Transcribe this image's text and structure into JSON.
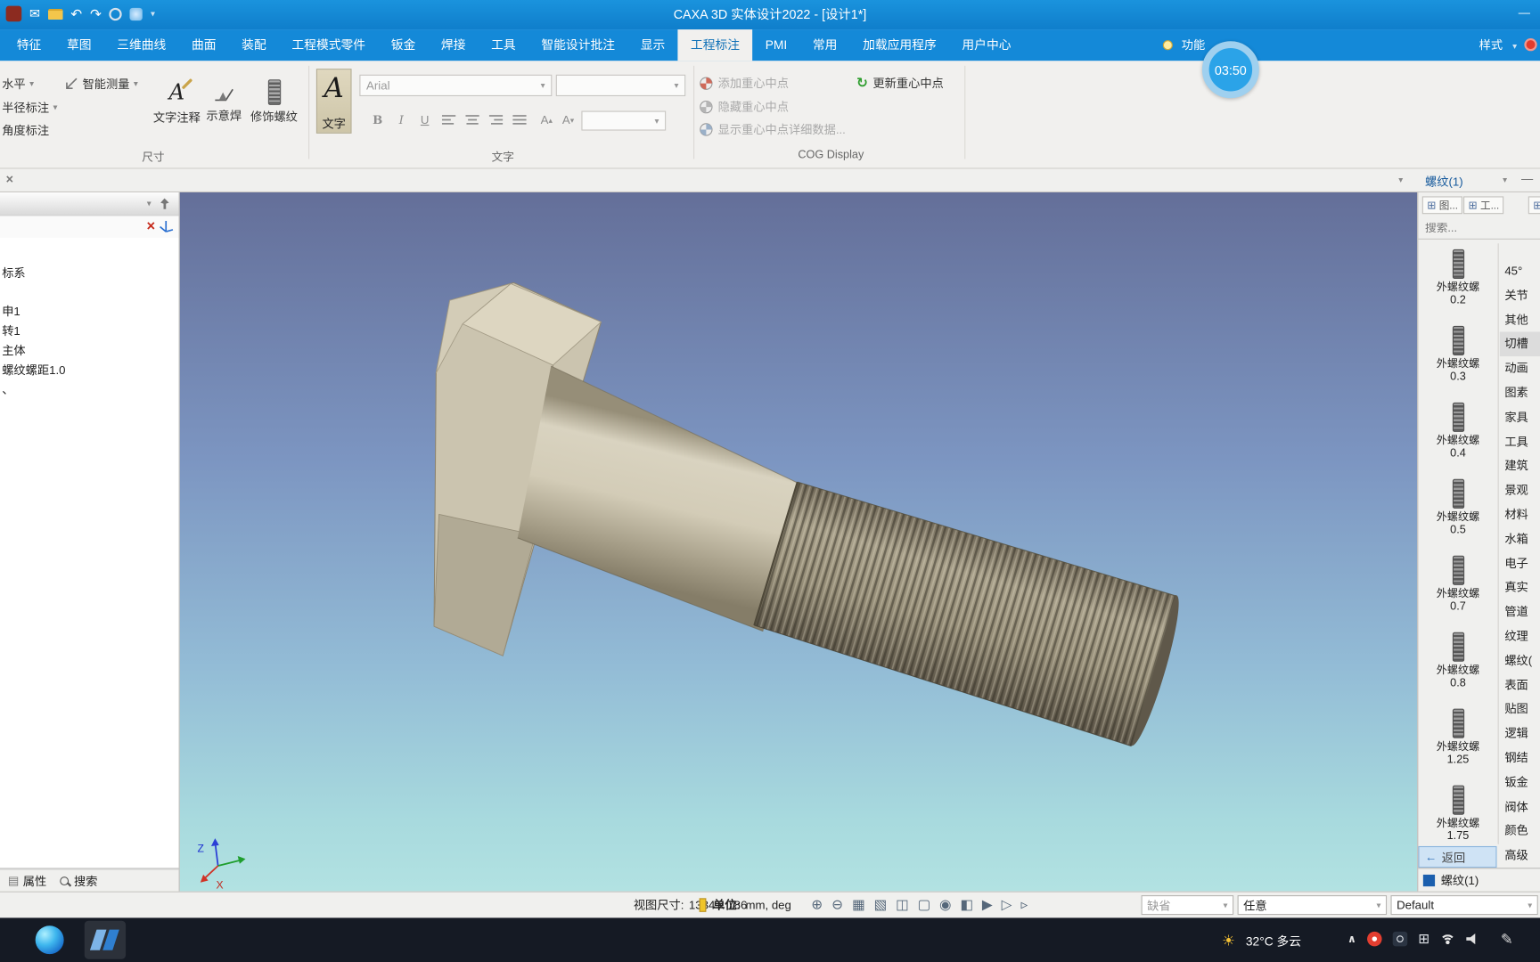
{
  "colors": {
    "titlebar_blue": "#1489d8",
    "accent_blue": "#1272b8",
    "ribbon_bg": "#f1f0ee",
    "viewport_top": "#646f99",
    "viewport_bottom": "#b2e2e2",
    "bolt_body": "#cbc4af",
    "thread_dark": "#5f584a",
    "taskbar_bg": "#151a24",
    "timer_bg": "#2ba3e8"
  },
  "icons": {
    "dropdown": "▾",
    "close": "×",
    "undo": "↶",
    "redo": "↷",
    "mail": "✉",
    "refresh": "↻",
    "back_arrow": "←",
    "chevron_up": "∧",
    "pen": "✎",
    "sun": "☀",
    "grid": "⊞",
    "tree_icon": "▤",
    "minimize": "—"
  },
  "titlebar": {
    "title": "CAXA 3D 实体设计2022 - [设计1*]"
  },
  "tabbar": {
    "tabs": [
      {
        "label": "特征"
      },
      {
        "label": "草图"
      },
      {
        "label": "三维曲线"
      },
      {
        "label": "曲面"
      },
      {
        "label": "装配"
      },
      {
        "label": "工程模式零件"
      },
      {
        "label": "钣金"
      },
      {
        "label": "焊接"
      },
      {
        "label": "工具"
      },
      {
        "label": "智能设计批注"
      },
      {
        "label": "显示"
      },
      {
        "label": "工程标注"
      },
      {
        "label": "PMI"
      },
      {
        "label": "常用"
      },
      {
        "label": "加载应用程序"
      },
      {
        "label": "用户中心"
      }
    ],
    "active_tab": "工程标注",
    "hint_label": "功能",
    "style_label": "样式",
    "recording_timer": "03:50"
  },
  "ribbon": {
    "dimension_group": {
      "horizontal": "水平",
      "radius": "半径标注",
      "angle": "角度标注",
      "smart_measure": "智能测量",
      "text_note": "文字注释",
      "weld_symbol": "示意焊",
      "cosmetic_thread": "修饰螺纹",
      "group_label": "尺寸"
    },
    "text_group": {
      "big_letter": "A",
      "text_button": "文字",
      "font_name": "Arial",
      "bold": "B",
      "italic": "I",
      "underline": "U",
      "size_up": "A",
      "size_down": "A",
      "group_label": "文字"
    },
    "cog_group": {
      "add_cog": "添加重心中点",
      "hide_cog": "隐藏重心中点",
      "show_cog_details": "显示重心中点详细数据...",
      "update_cog": "更新重心中点",
      "group_label": "COG Display"
    }
  },
  "left_panel": {
    "tree_items": [
      {
        "label": "标系"
      },
      {
        "label": "申1"
      },
      {
        "label": "转1"
      },
      {
        "label": "主体"
      },
      {
        "label": "螺纹螺距1.0"
      },
      {
        "label": "、"
      }
    ],
    "properties_tab": "属性",
    "search_tab": "搜索"
  },
  "viewport": {
    "axis_z": "Z",
    "axis_x": "X"
  },
  "right_panel": {
    "header": "螺纹(1)",
    "toolbar": [
      {
        "label": "图..."
      },
      {
        "label": "工..."
      }
    ],
    "search_placeholder": "搜索...",
    "thread_items": [
      {
        "name": "外螺纹螺",
        "value": "0.2"
      },
      {
        "name": "外螺纹螺",
        "value": "0.3"
      },
      {
        "name": "外螺纹螺",
        "value": "0.4"
      },
      {
        "name": "外螺纹螺",
        "value": "0.5"
      },
      {
        "name": "外螺纹螺",
        "value": "0.7"
      },
      {
        "name": "外螺纹螺",
        "value": "0.8"
      },
      {
        "name": "外螺纹螺",
        "value": "1.25"
      },
      {
        "name": "外螺纹螺",
        "value": "1.75"
      }
    ],
    "categories": [
      "45°",
      "关节",
      "其他",
      "切槽",
      "动画",
      "图素",
      "家具",
      "工具",
      "建筑",
      "景观",
      "材料",
      "水箱",
      "电子",
      "真实",
      "管道",
      "纹理",
      "螺纹(",
      "表面",
      "贴图",
      "逻辑",
      "钢结",
      "钣金",
      "阀体",
      "颜色",
      "高级"
    ],
    "back_label": "返回",
    "footer_label": "螺纹(1)"
  },
  "status_bar": {
    "view_size_label": "视图尺寸:",
    "view_size_value": "1384 x  786",
    "units_label": "单位:",
    "units_value": "mm, deg",
    "icons": [
      {
        "glyph": "⊕"
      },
      {
        "glyph": "⊖"
      },
      {
        "glyph": "▦"
      },
      {
        "glyph": "▧"
      },
      {
        "glyph": "◫"
      },
      {
        "glyph": "▢"
      },
      {
        "glyph": "◉"
      },
      {
        "glyph": "◧"
      },
      {
        "glyph": "▶"
      },
      {
        "glyph": "▷"
      },
      {
        "glyph": "▹"
      }
    ],
    "preset_default": "缺省",
    "preset_any": "任意",
    "preset_style": "Default"
  },
  "taskbar": {
    "weather": "32°C 多云"
  }
}
